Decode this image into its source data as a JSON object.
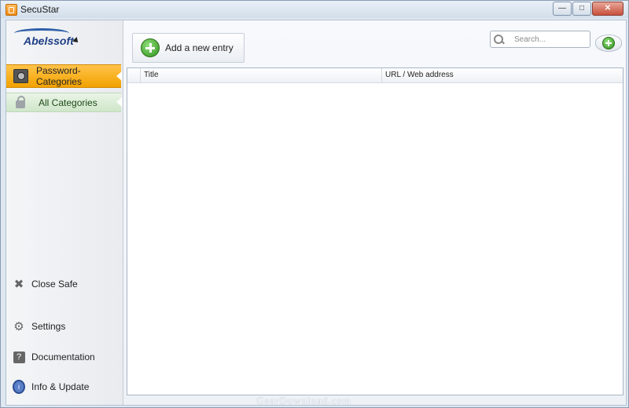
{
  "window": {
    "title": "SecuStar"
  },
  "logo": {
    "text": "Abelssoft"
  },
  "sidebar": {
    "header": {
      "label": "Password-Categories",
      "icon": "camera-icon"
    },
    "categories": [
      {
        "label": "All Categories",
        "icon": "lock-icon"
      }
    ],
    "nav": [
      {
        "label": "Close Safe",
        "icon": "close-icon"
      },
      {
        "label": "Settings",
        "icon": "gear-icon"
      },
      {
        "label": "Documentation",
        "icon": "help-icon"
      },
      {
        "label": "Info & Update",
        "icon": "info-icon"
      }
    ]
  },
  "toolbar": {
    "add_label": "Add a new entry"
  },
  "search": {
    "placeholder": "Search...",
    "value": ""
  },
  "table": {
    "columns": [
      "Title",
      "URL / Web address"
    ],
    "rows": []
  },
  "watermark": "GearDownload.com",
  "colors": {
    "accent": "#f2a200",
    "category_bg": "#cfe6c9",
    "plus_green": "#2f8f1c"
  }
}
